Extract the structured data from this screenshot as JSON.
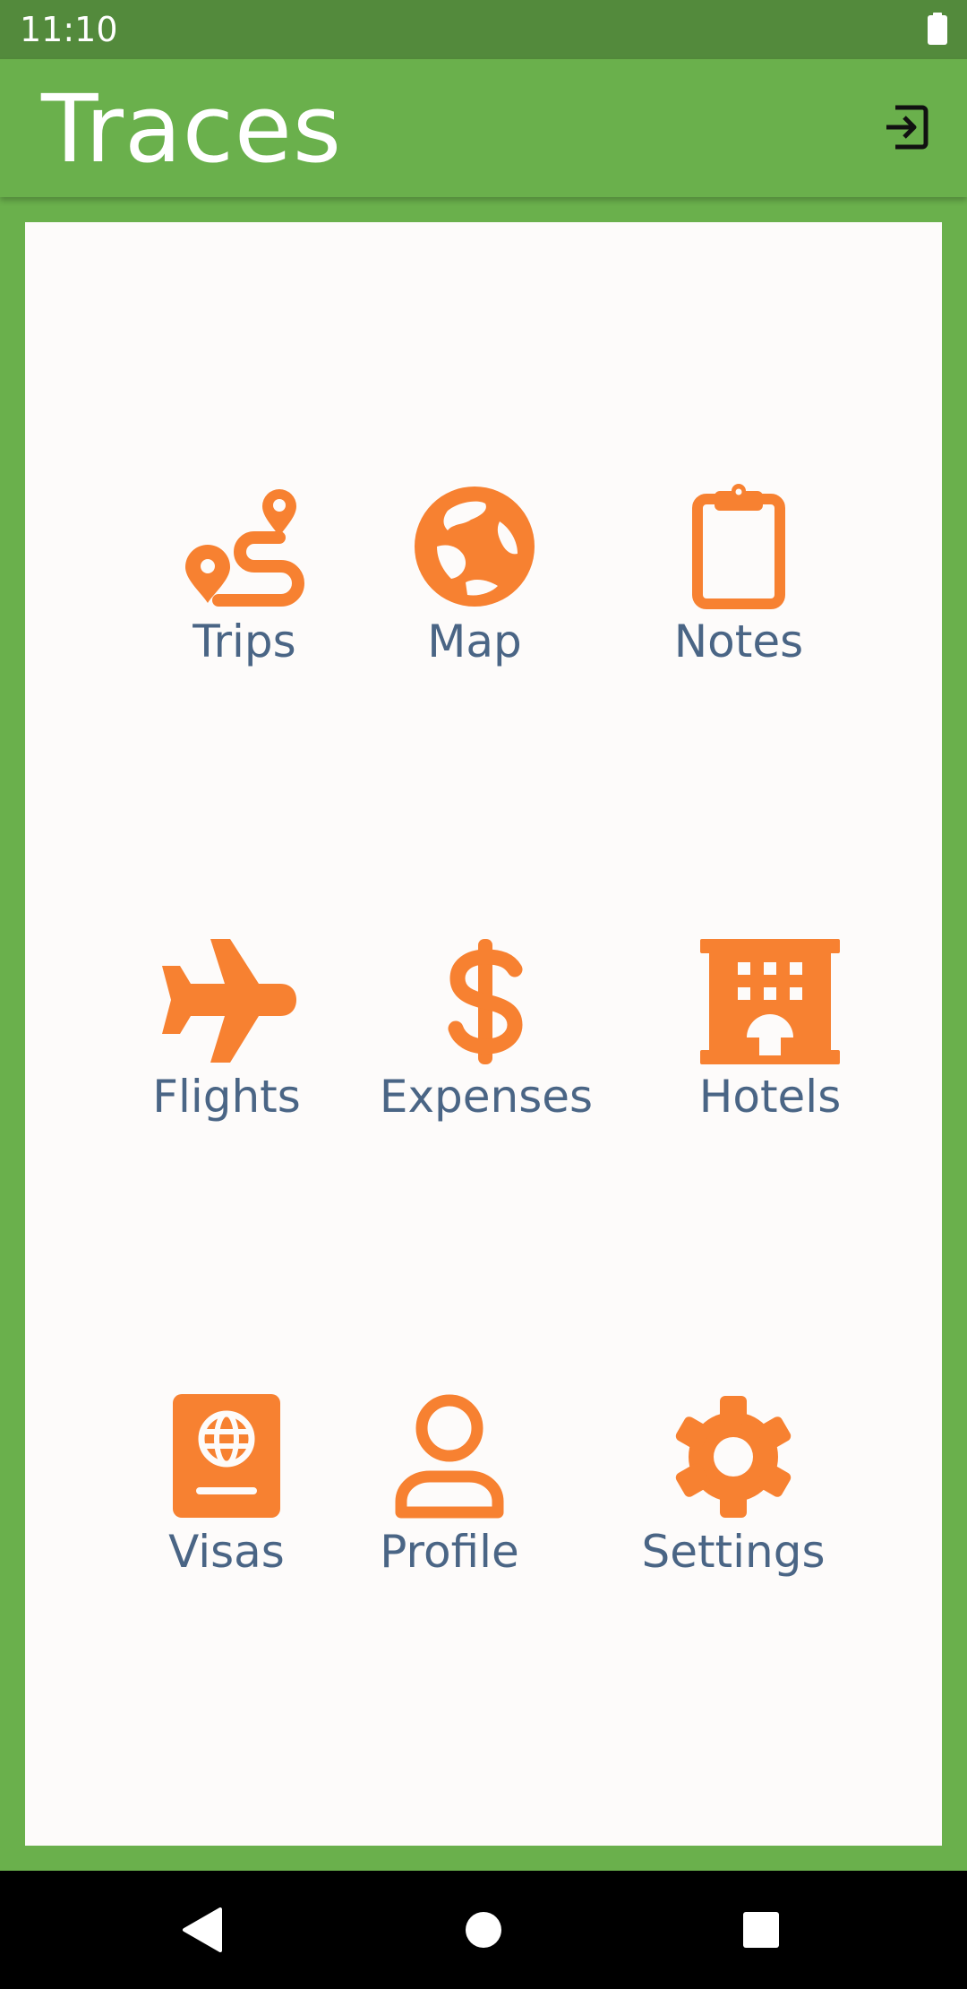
{
  "status_bar": {
    "time": "11:10"
  },
  "app_bar": {
    "title": "Traces",
    "logout_icon": "logout-icon"
  },
  "colors": {
    "accent": "#6ab04c",
    "status_bar": "#538a3c",
    "icon": "#f78131",
    "label": "#4a6585",
    "card": "#fdfbfa"
  },
  "menu": [
    {
      "label": "Trips",
      "icon": "route-icon"
    },
    {
      "label": "Map",
      "icon": "globe-icon"
    },
    {
      "label": "Notes",
      "icon": "clipboard-icon"
    },
    {
      "label": "Flights",
      "icon": "airplane-icon"
    },
    {
      "label": "Expenses",
      "icon": "dollar-icon"
    },
    {
      "label": "Hotels",
      "icon": "hotel-icon"
    },
    {
      "label": "Visas",
      "icon": "passport-icon"
    },
    {
      "label": "Profile",
      "icon": "user-icon"
    },
    {
      "label": "Settings",
      "icon": "gear-icon"
    }
  ],
  "nav": {
    "back": "back-icon",
    "home": "home-icon",
    "recents": "recents-icon"
  }
}
